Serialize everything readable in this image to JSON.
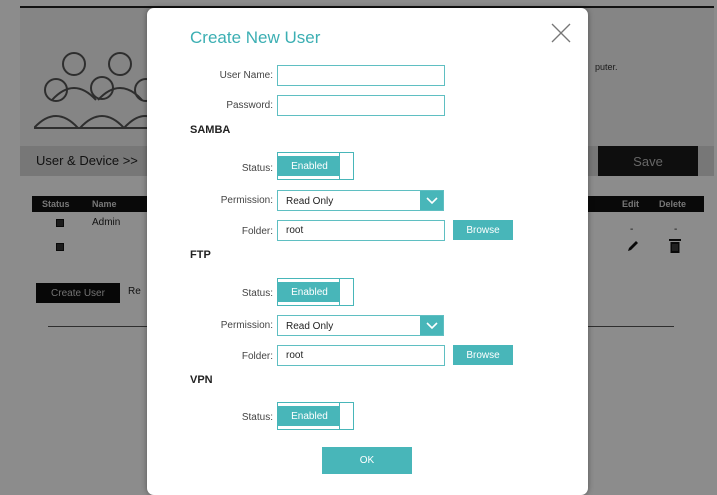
{
  "background": {
    "description_fragment": "puter.",
    "section_title": "User & Device >>",
    "save_label": "Save",
    "table": {
      "headers": [
        "Status",
        "Name",
        "Edit",
        "Delete"
      ],
      "rows": [
        {
          "name": "Admin",
          "edit": "-",
          "delete": "-"
        },
        {
          "name": "",
          "edit": "",
          "delete": ""
        }
      ]
    },
    "create_user_label": "Create User",
    "truncated_label": "Re"
  },
  "modal": {
    "title": "Create New User",
    "username": {
      "label": "User Name:",
      "value": ""
    },
    "password": {
      "label": "Password:",
      "value": ""
    },
    "samba": {
      "heading": "SAMBA",
      "status_label": "Status:",
      "status_value": "Enabled",
      "permission_label": "Permission:",
      "permission_value": "Read Only",
      "folder_label": "Folder:",
      "folder_value": "root",
      "browse_label": "Browse"
    },
    "ftp": {
      "heading": "FTP",
      "status_label": "Status:",
      "status_value": "Enabled",
      "permission_label": "Permission:",
      "permission_value": "Read Only",
      "folder_label": "Folder:",
      "folder_value": "root",
      "browse_label": "Browse"
    },
    "vpn": {
      "heading": "VPN",
      "status_label": "Status:",
      "status_value": "Enabled"
    },
    "ok_label": "OK"
  },
  "colors": {
    "accent": "#48b6b9",
    "title": "#3cafb3",
    "overlay": "rgba(0,0,0,0.45)"
  },
  "icons": [
    "users-illustration",
    "close-icon",
    "chevron-down-icon",
    "edit-pencil-icon",
    "trash-icon",
    "checkbox-icon"
  ]
}
